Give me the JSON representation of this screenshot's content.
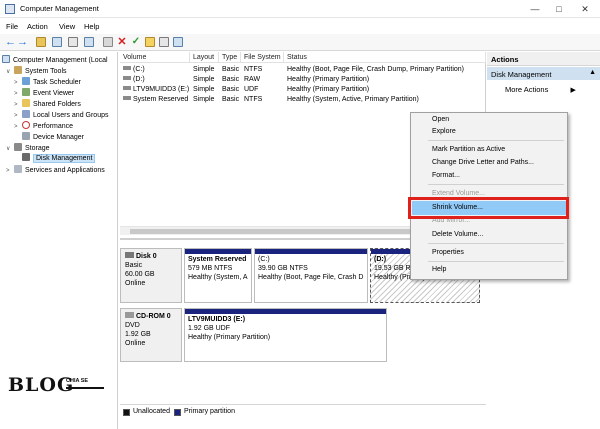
{
  "window": {
    "title": "Computer Management",
    "minimize": "—",
    "maximize": "□",
    "close": "✕"
  },
  "menu": [
    "File",
    "Action",
    "View",
    "Help"
  ],
  "toolbar_icons": [
    "back-arrow-icon",
    "forward-arrow-icon",
    "up-folder-icon",
    "console-tree-icon",
    "properties-icon",
    "help-icon",
    "connect-icon",
    "delete-icon",
    "check-icon",
    "export-icon",
    "refresh-icon",
    "zoom-icon"
  ],
  "tree": [
    {
      "label": "Computer Management (Local",
      "level": 0,
      "arrow": ""
    },
    {
      "label": "System Tools",
      "level": 1,
      "arrow": "∨"
    },
    {
      "label": "Task Scheduler",
      "level": 2,
      "arrow": ">"
    },
    {
      "label": "Event Viewer",
      "level": 2,
      "arrow": ">"
    },
    {
      "label": "Shared Folders",
      "level": 2,
      "arrow": ">"
    },
    {
      "label": "Local Users and Groups",
      "level": 2,
      "arrow": ">"
    },
    {
      "label": "Performance",
      "level": 2,
      "arrow": ">"
    },
    {
      "label": "Device Manager",
      "level": 2,
      "arrow": ""
    },
    {
      "label": "Storage",
      "level": 1,
      "arrow": "∨"
    },
    {
      "label": "Disk Management",
      "level": 2,
      "arrow": "",
      "selected": true
    },
    {
      "label": "Services and Applications",
      "level": 1,
      "arrow": ">"
    }
  ],
  "volumes": {
    "headers": [
      "Volume",
      "Layout",
      "Type",
      "File System",
      "Status"
    ],
    "rows": [
      [
        "(C:)",
        "Simple",
        "Basic",
        "NTFS",
        "Healthy (Boot, Page File, Crash Dump, Primary Partition)"
      ],
      [
        "(D:)",
        "Simple",
        "Basic",
        "RAW",
        "Healthy (Primary Partition)"
      ],
      [
        "LTV9MUIDD3 (E:)",
        "Simple",
        "Basic",
        "UDF",
        "Healthy (Primary Partition)"
      ],
      [
        "System Reserved",
        "Simple",
        "Basic",
        "NTFS",
        "Healthy (System, Active, Primary Partition)"
      ]
    ]
  },
  "disks": [
    {
      "name": "Disk 0",
      "type": "Basic",
      "size": "60.00 GB",
      "state": "Online",
      "partitions": [
        {
          "title": "System Reserved",
          "size": "579 MB NTFS",
          "status": "Healthy (System, A"
        },
        {
          "title": "(C:)",
          "size": "39.90 GB NTFS",
          "status": "Healthy (Boot, Page File, Crash D"
        },
        {
          "title": "(D:)",
          "size": "19.53 GB RAW",
          "status": "Healthy (Primary Partition)"
        }
      ]
    },
    {
      "name": "CD-ROM 0",
      "type": "DVD",
      "size": "1.92 GB",
      "state": "Online",
      "partitions": [
        {
          "title": "LTV9MUIDD3  (E:)",
          "size": "1.92 GB UDF",
          "status": "Healthy (Primary Partition)"
        }
      ]
    }
  ],
  "legend": {
    "unallocated": "Unallocated",
    "primary": "Primary partition"
  },
  "actions": {
    "header": "Actions",
    "section": "Disk Management",
    "more": "More Actions"
  },
  "context_menu": [
    {
      "label": "Open",
      "enabled": true
    },
    {
      "label": "Explore",
      "enabled": true
    },
    {
      "label": "Mark Partition as Active",
      "enabled": true
    },
    {
      "label": "Change Drive Letter and Paths...",
      "enabled": true
    },
    {
      "label": "Format...",
      "enabled": true
    },
    {
      "label": "Extend Volume...",
      "enabled": false
    },
    {
      "label": "Shrink Volume...",
      "enabled": true,
      "highlighted": true
    },
    {
      "label": "Add Mirror...",
      "enabled": false
    },
    {
      "label": "Delete Volume...",
      "enabled": true
    },
    {
      "label": "Properties",
      "enabled": true
    },
    {
      "label": "Help",
      "enabled": true
    }
  ],
  "watermark": {
    "big": "BLOG",
    "small": "CHIA SE"
  },
  "colors": {
    "primary_partition": "#1a237e",
    "highlight_box": "#e0201b",
    "menu_highlight": "#91c9f7"
  }
}
